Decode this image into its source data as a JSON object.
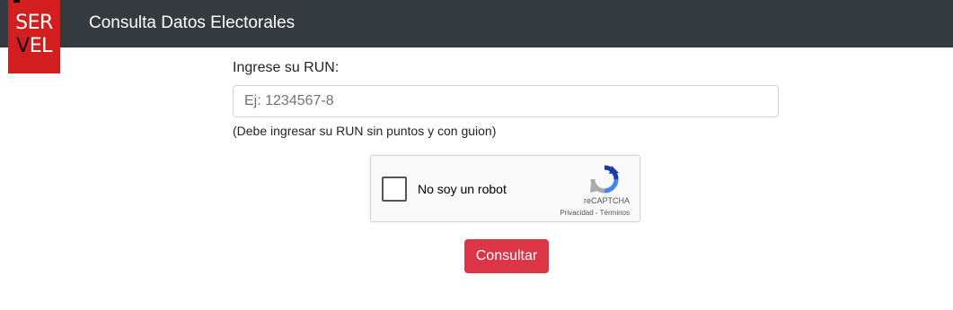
{
  "brand": {
    "logo_text": [
      "SER",
      "VEL"
    ],
    "title": "Consulta Datos Electorales"
  },
  "form": {
    "run_label": "Ingrese su RUN:",
    "run_placeholder": "Ej: 1234567-8",
    "run_value": "",
    "run_help": "(Debe ingresar su RUN sin puntos y con guion)",
    "submit_label": "Consultar"
  },
  "captcha": {
    "checkbox_label": "No soy un robot",
    "brand": "reCAPTCHA",
    "privacy": "Privacidad",
    "separator": " - ",
    "terms": "Términos"
  },
  "colors": {
    "navbar": "#343a40",
    "logo": "#d21e1e",
    "primary_button": "#dc3545"
  }
}
